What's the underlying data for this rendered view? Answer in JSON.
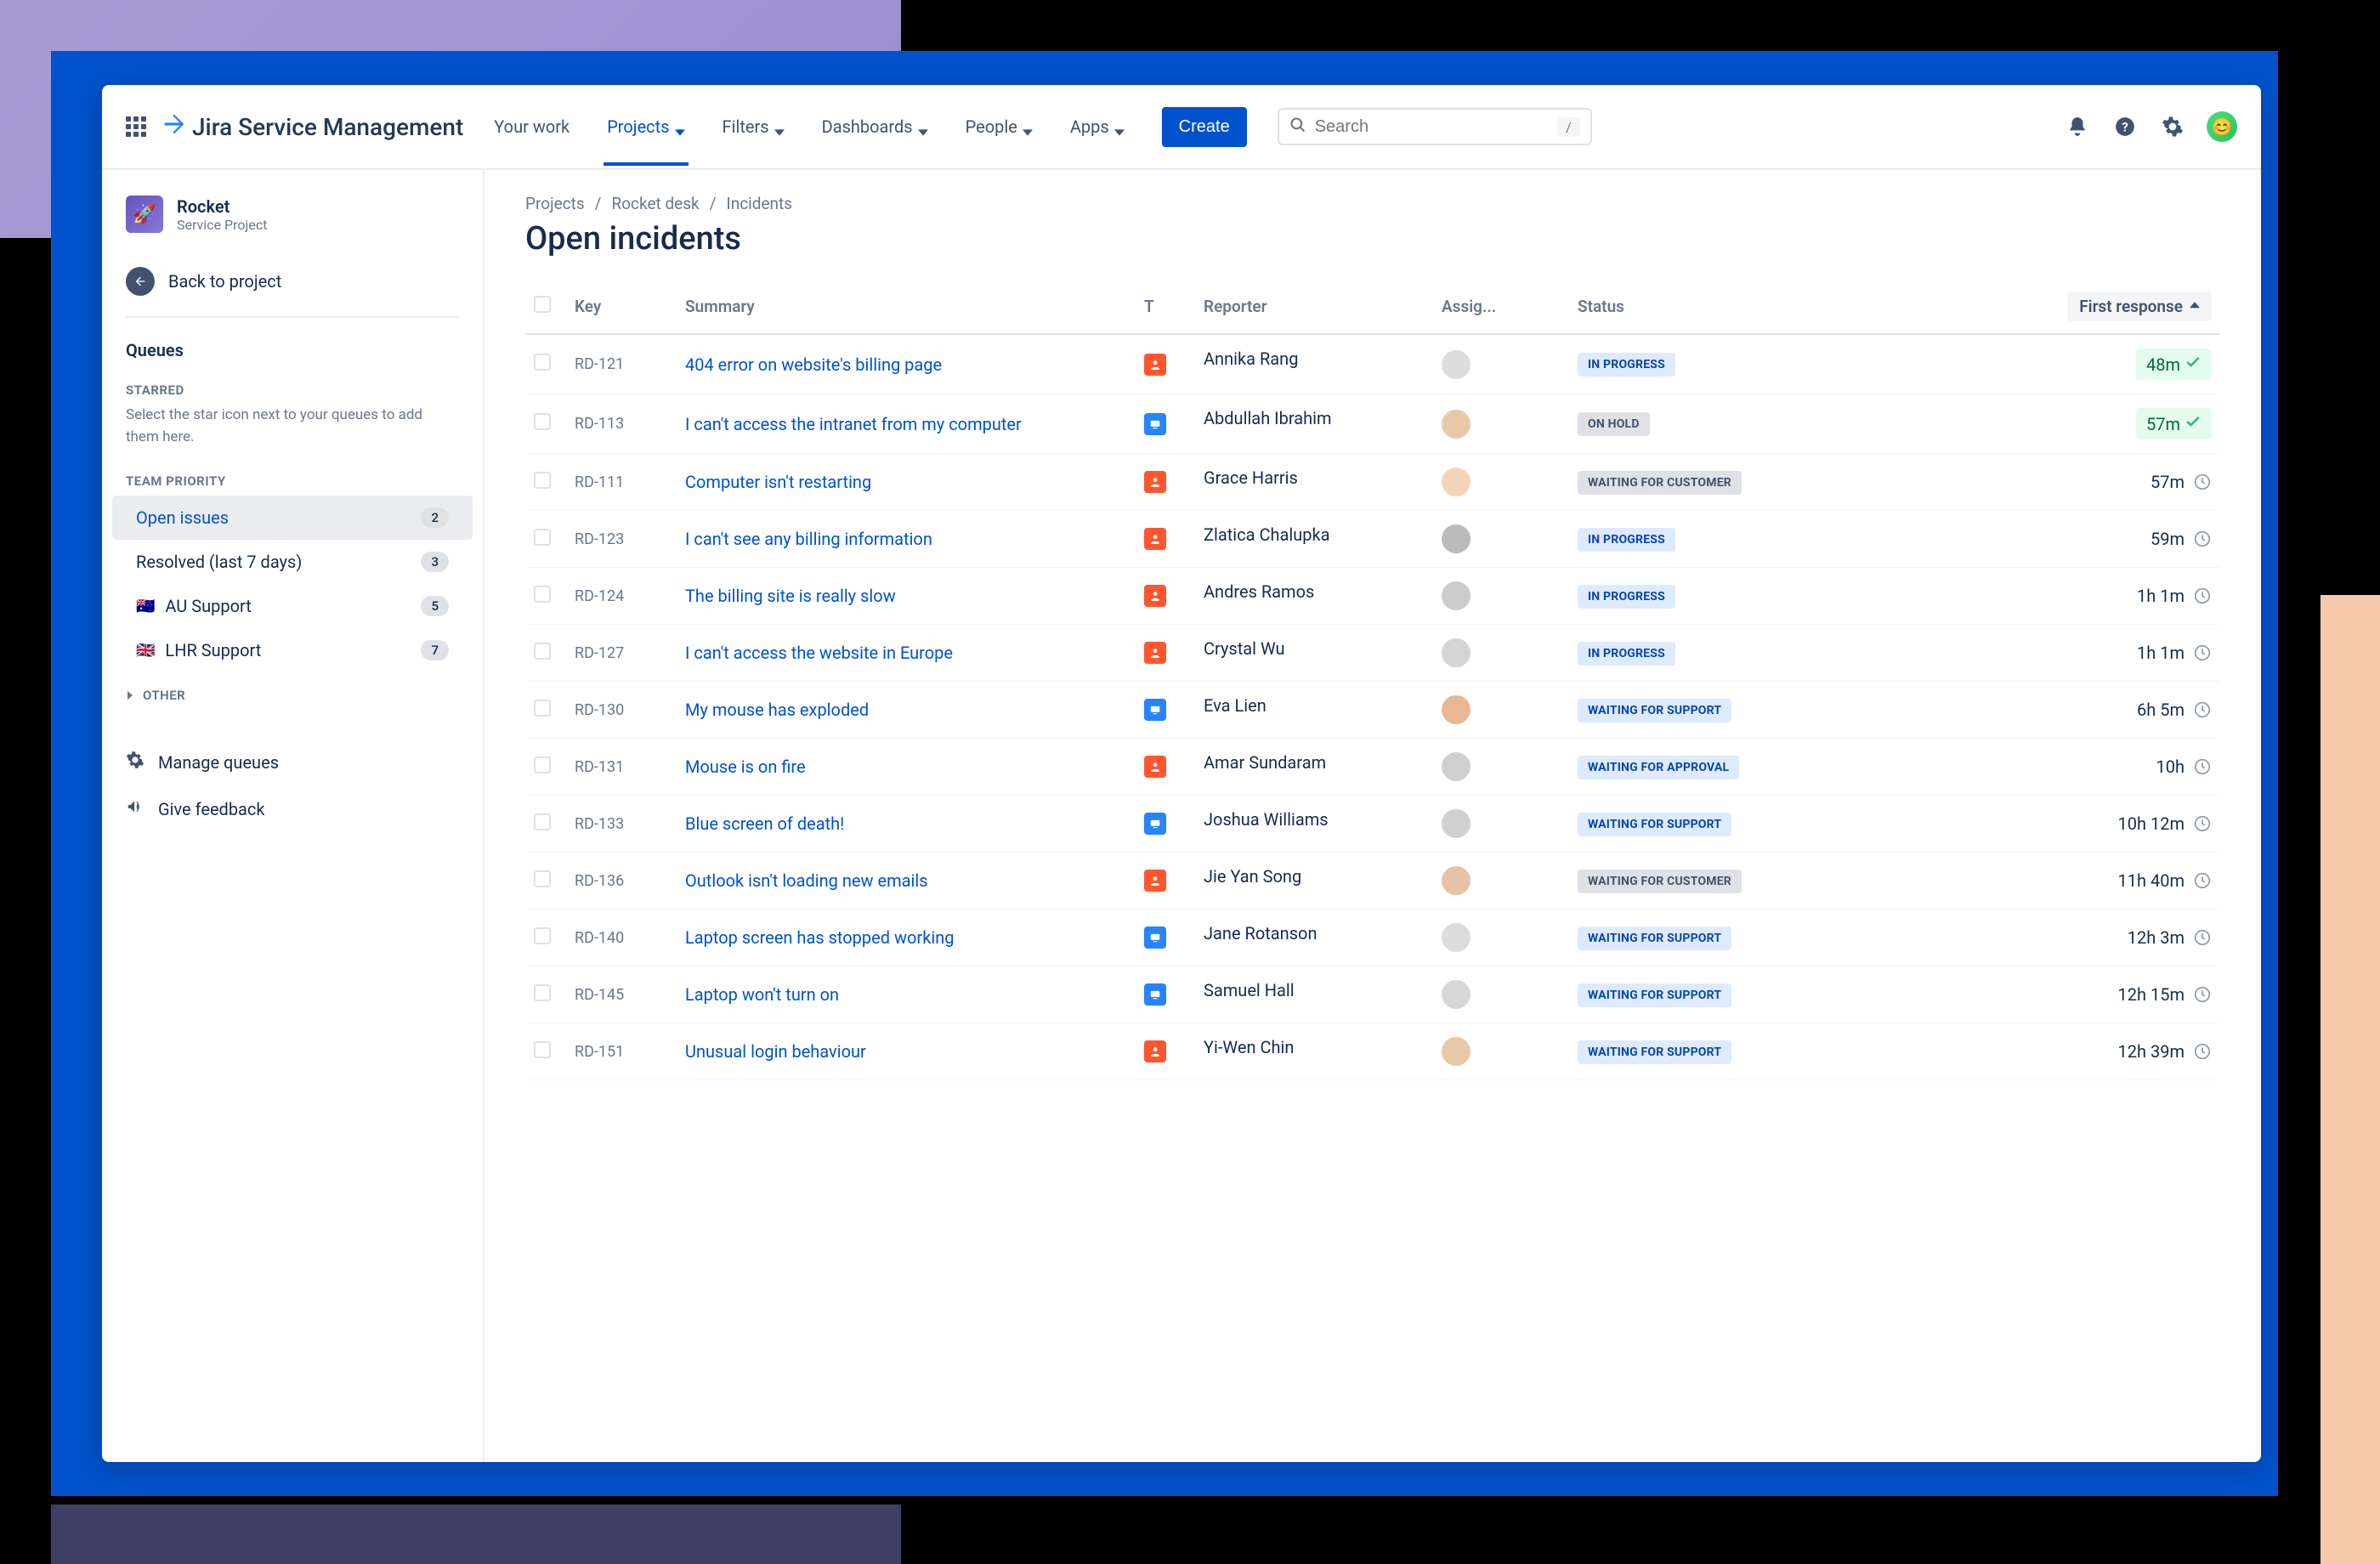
{
  "product": "Jira Service Management",
  "topnav": {
    "your_work": "Your work",
    "projects": "Projects",
    "filters": "Filters",
    "dashboards": "Dashboards",
    "people": "People",
    "apps": "Apps",
    "create": "Create",
    "search_placeholder": "Search",
    "search_kbd": "/"
  },
  "sidebar": {
    "project_name": "Rocket",
    "project_type": "Service Project",
    "back": "Back to project",
    "queues": "Queues",
    "starred_label": "STARRED",
    "starred_help": "Select the star icon next to your queues to add them here.",
    "team_priority_label": "TEAM PRIORITY",
    "items": [
      {
        "label": "Open issues",
        "count": "2",
        "flag": ""
      },
      {
        "label": "Resolved (last 7 days)",
        "count": "3",
        "flag": ""
      },
      {
        "label": "AU Support",
        "count": "5",
        "flag": "🇦🇺"
      },
      {
        "label": "LHR Support",
        "count": "7",
        "flag": "🇬🇧"
      }
    ],
    "other_label": "OTHER",
    "manage": "Manage queues",
    "feedback": "Give feedback"
  },
  "breadcrumbs": [
    "Projects",
    "Rocket desk",
    "Incidents"
  ],
  "page_title": "Open incidents",
  "columns": {
    "key": "Key",
    "summary": "Summary",
    "type": "T",
    "reporter": "Reporter",
    "assignee": "Assig...",
    "status": "Status",
    "first_response": "First response"
  },
  "status_labels": {
    "in_progress": "IN PROGRESS",
    "on_hold": "ON HOLD",
    "waiting_for_customer": "WAITING FOR CUSTOMER",
    "waiting_for_support": "WAITING FOR SUPPORT",
    "waiting_for_approval": "WAITING FOR APPROVAL"
  },
  "rows": [
    {
      "key": "RD-121",
      "summary": "404 error on website's billing page",
      "type": "orange",
      "reporter": "Annika Rang",
      "status": "in_progress",
      "resp": "48m",
      "resp_style": "pill",
      "av": "#ddd"
    },
    {
      "key": "RD-113",
      "summary": "I can't access the intranet from my computer",
      "type": "blue",
      "reporter": "Abdullah Ibrahim",
      "status": "on_hold",
      "resp": "57m",
      "resp_style": "pill",
      "av": "#e7c9a9"
    },
    {
      "key": "RD-111",
      "summary": "Computer isn't restarting",
      "type": "orange",
      "reporter": "Grace Harris",
      "status": "waiting_for_customer",
      "resp": "57m",
      "resp_style": "clock",
      "av": "#f2d5b8"
    },
    {
      "key": "RD-123",
      "summary": "I can't see any billing information",
      "type": "orange",
      "reporter": "Zlatica Chalupka",
      "status": "in_progress",
      "resp": "59m",
      "resp_style": "clock",
      "av": "#bbb"
    },
    {
      "key": "RD-124",
      "summary": "The billing site is really slow",
      "type": "orange",
      "reporter": "Andres Ramos",
      "status": "in_progress",
      "resp": "1h 1m",
      "resp_style": "clock",
      "av": "#ccc"
    },
    {
      "key": "RD-127",
      "summary": "I can't access the website in Europe",
      "type": "orange",
      "reporter": "Crystal Wu",
      "status": "in_progress",
      "resp": "1h 1m",
      "resp_style": "clock",
      "av": "#d4d4d4"
    },
    {
      "key": "RD-130",
      "summary": "My mouse has exploded",
      "type": "blue",
      "reporter": "Eva Lien",
      "status": "waiting_for_support",
      "resp": "6h 5m",
      "resp_style": "clock",
      "av": "#e8b894"
    },
    {
      "key": "RD-131",
      "summary": "Mouse is on fire",
      "type": "orange",
      "reporter": "Amar Sundaram",
      "status": "waiting_for_approval",
      "resp": "10h",
      "resp_style": "clock",
      "av": "#cfcfcf"
    },
    {
      "key": "RD-133",
      "summary": "Blue screen of death!",
      "type": "blue",
      "reporter": "Joshua Williams",
      "status": "waiting_for_support",
      "resp": "10h 12m",
      "resp_style": "clock",
      "av": "#d0d0d0"
    },
    {
      "key": "RD-136",
      "summary": "Outlook isn't loading new emails",
      "type": "orange",
      "reporter": "Jie Yan Song",
      "status": "waiting_for_customer",
      "resp": "11h 40m",
      "resp_style": "clock",
      "av": "#e6c2a6"
    },
    {
      "key": "RD-140",
      "summary": "Laptop screen has stopped working",
      "type": "blue",
      "reporter": "Jane Rotanson",
      "status": "waiting_for_support",
      "resp": "12h 3m",
      "resp_style": "clock",
      "av": "#dcdcdc"
    },
    {
      "key": "RD-145",
      "summary": "Laptop won't turn on",
      "type": "blue",
      "reporter": "Samuel Hall",
      "status": "waiting_for_support",
      "resp": "12h 15m",
      "resp_style": "clock",
      "av": "#d7d7d7"
    },
    {
      "key": "RD-151",
      "summary": "Unusual login behaviour",
      "type": "orange",
      "reporter": "Yi-Wen Chin",
      "status": "waiting_for_support",
      "resp": "12h 39m",
      "resp_style": "clock",
      "av": "#e8c8a8"
    }
  ]
}
